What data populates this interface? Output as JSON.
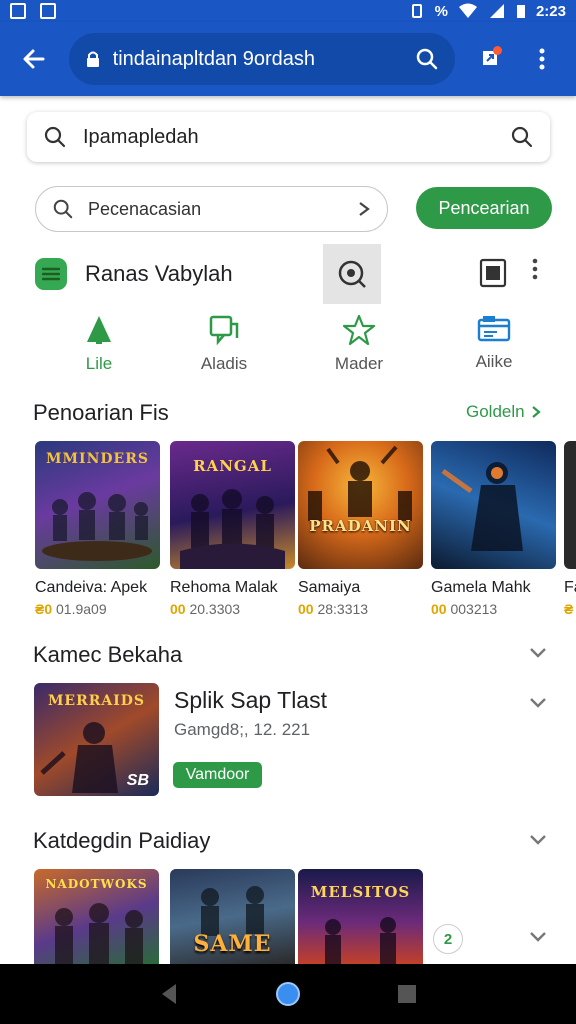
{
  "status_bar": {
    "time": "2:23",
    "battery": "%"
  },
  "app_bar": {
    "url": "tindainapltdan 9ordash"
  },
  "main_search": {
    "query": "Ipamapledah"
  },
  "sub_search": {
    "query": "Pecenacasian",
    "button_label": "Pencearian"
  },
  "app_label": {
    "title": "Ranas Vabylah"
  },
  "categories": [
    {
      "label": "Lile",
      "icon": "tree-icon",
      "active": true
    },
    {
      "label": "Aladis",
      "icon": "chat-icon",
      "active": false
    },
    {
      "label": "Mader",
      "icon": "star-icon",
      "active": false
    },
    {
      "label": "Aiike",
      "icon": "card-icon",
      "active": false
    }
  ],
  "section1": {
    "title": "Penoarian Fis",
    "see_more": "Goldeln"
  },
  "games": [
    {
      "name": "Candeiva: Apek",
      "rating": "01.9a09",
      "art_text": "MMINDERS"
    },
    {
      "name": "Rehoma Malak",
      "rating": "20.3303",
      "art_text": "RANGAL"
    },
    {
      "name": "Samaiya",
      "rating": "28:3313",
      "art_text": "PRADANIN"
    },
    {
      "name": "Gamela Mahk",
      "rating": "003213",
      "art_text": ""
    },
    {
      "name": "Fa",
      "rating": "",
      "art_text": ""
    }
  ],
  "section2": {
    "title": "Kamec Bekaha"
  },
  "featured": {
    "title": "Splik Sap Tlast",
    "subtitle": "Gamgd8;, 12. 221",
    "tag": "Vamdoor",
    "art_text": "MERRAIDS",
    "art_corner": "SB"
  },
  "section3": {
    "title": "Katdegdin Paidiay"
  },
  "thumbs": [
    {
      "art_text": "NADOTWOKS"
    },
    {
      "art_text": "SAME"
    },
    {
      "art_text": "MELSITOS"
    }
  ],
  "round_badge": "2",
  "colors": {
    "primary": "#1a56c4",
    "accent_green": "#2e9a48",
    "rating_gold": "#e0a500"
  }
}
